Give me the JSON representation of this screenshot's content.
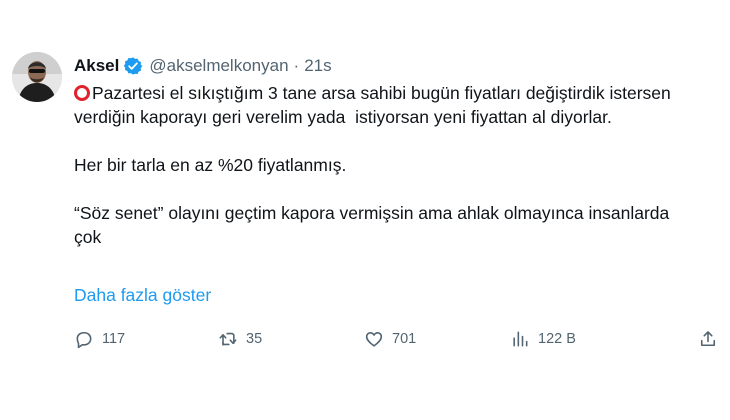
{
  "author": {
    "display_name": "Aksel",
    "handle": "@akselmelkonyan",
    "separator": "·",
    "time": "21s",
    "verified_color": "#1d9bf0",
    "avatar": "profile-photo"
  },
  "tweet": {
    "line1": "Pazartesi el sıkıştığım 3 tane arsa sahibi bugün fiyatları değiştirdik istersen verdiğin kaporayı geri verelim yada  istiyorsan yeni fiyattan al diyorlar.",
    "line2": "Her bir tarla en az %20 fiyatlanmış.",
    "line3": "“Söz senet” olayını geçtim kapora vermişsin ama ahlak olmayınca insanlarda çok",
    "emoji": "hollow-red-circle",
    "show_more": "Daha fazla göster"
  },
  "actions": {
    "replies": "117",
    "retweets": "35",
    "likes": "701",
    "views": "122 B"
  },
  "colors": {
    "text": "#0f1419",
    "secondary": "#536471",
    "link": "#1d9bf0",
    "emoji_red": "#e0222c"
  }
}
